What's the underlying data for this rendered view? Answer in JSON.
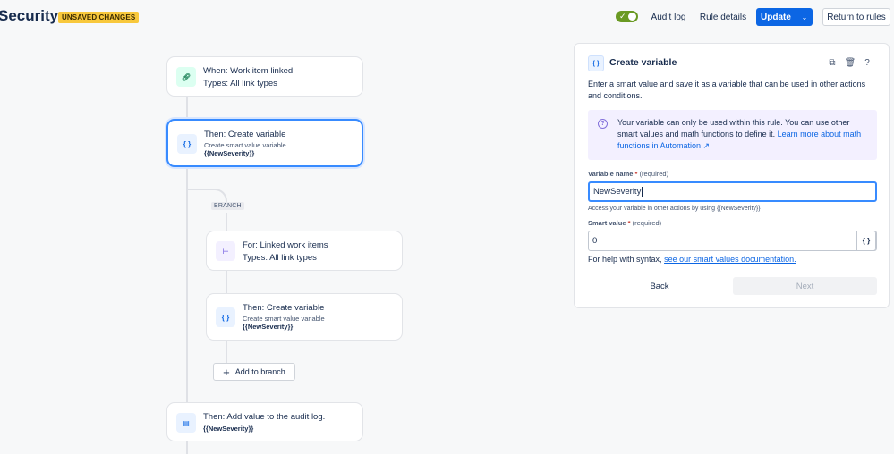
{
  "header": {
    "title": "Security",
    "badge": "UNSAVED CHANGES",
    "audit_log": "Audit log",
    "rule_details": "Rule details",
    "update": "Update",
    "return": "Return to rules"
  },
  "flow": {
    "trigger": {
      "line1": "When: Work item linked",
      "line2": "Types: All link types"
    },
    "create_var": {
      "line1": "Then: Create variable",
      "line2": "Create smart value variable",
      "line3": "{{NewSeverity}}"
    },
    "branch_tag": "BRANCH",
    "for_each": {
      "line1": "For: Linked work items",
      "line2": "Types: All link types"
    },
    "branch_create_var": {
      "line1": "Then: Create variable",
      "line2": "Create smart value variable",
      "line3": "{{NewSeverity}}"
    },
    "add_to_branch": "Add to branch",
    "audit_action": {
      "line1": "Then: Add value to the audit log.",
      "line2": "{{NewSeverity}}"
    }
  },
  "panel": {
    "title": "Create variable",
    "description": "Enter a smart value and save it as a variable that can be used in other actions and conditions.",
    "info_text": "Your variable can only be used within this rule. You can use other smart values and math functions to define it.",
    "info_link": "Learn more about math functions in Automation ↗",
    "variable_name_label": "Variable name",
    "variable_name_req": "(required)",
    "variable_name_value": "NewSeverity",
    "variable_hint": "Access your variable in other actions by using {{NewSeverity}}",
    "smart_value_label": "Smart value",
    "smart_value_req": "(required)",
    "smart_value_value": "0",
    "help_prefix": "For help with syntax,",
    "help_link": "see our smart values documentation.",
    "back": "Back",
    "next": "Next"
  },
  "colors": {
    "primary": "#0c66e4",
    "badge": "#f8c83c",
    "toggle_on": "#6a9a23",
    "info_bg": "#f3f0ff"
  },
  "icons": {
    "trigger": "link-icon",
    "create_variable": "braces-icon",
    "for_each": "branch-icon",
    "audit": "log-icon"
  }
}
